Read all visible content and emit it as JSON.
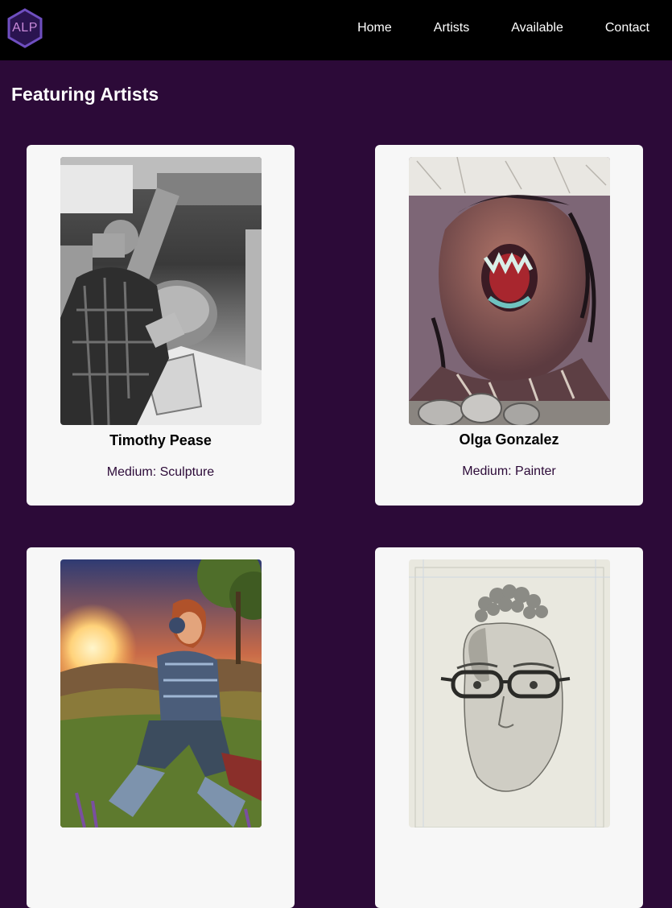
{
  "nav": {
    "logo_text": "ALP",
    "links": [
      "Home",
      "Artists",
      "Available",
      "Contact"
    ]
  },
  "section": {
    "title": "Featuring Artists"
  },
  "artists": [
    {
      "name": "Timothy Pease",
      "medium": "Medium: Sculpture"
    },
    {
      "name": "Olga Gonzalez",
      "medium": "Medium: Painter"
    },
    {
      "name": "",
      "medium": ""
    },
    {
      "name": "",
      "medium": ""
    }
  ],
  "colors": {
    "background": "#2c0a38",
    "navbar": "#000000",
    "card": "#f7f7f7",
    "logo_accent": "#7b4fc9"
  }
}
